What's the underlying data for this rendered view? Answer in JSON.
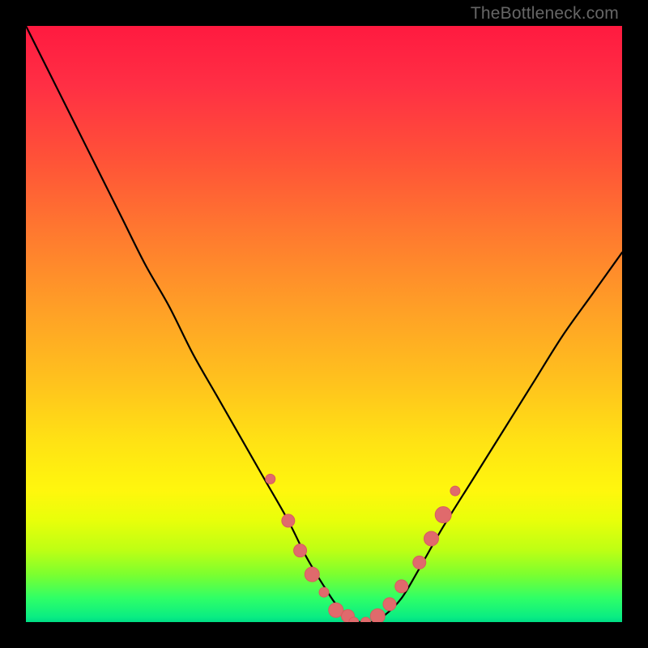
{
  "attribution": "TheBottleneck.com",
  "colors": {
    "curve_stroke": "#000000",
    "dot_fill": "#e06a6c",
    "dot_stroke": "#d85c5e"
  },
  "chart_data": {
    "type": "line",
    "title": "",
    "xlabel": "",
    "ylabel": "",
    "xlim": [
      0,
      100
    ],
    "ylim": [
      0,
      100
    ],
    "grid": false,
    "legend": false,
    "annotations": [],
    "curve": {
      "name": "bottleneck-curve",
      "x": [
        0,
        4,
        8,
        12,
        16,
        20,
        24,
        28,
        32,
        36,
        40,
        44,
        47,
        50,
        52,
        54,
        56,
        58,
        60,
        63,
        66,
        70,
        75,
        80,
        85,
        90,
        95,
        100
      ],
      "y": [
        100,
        92,
        84,
        76,
        68,
        60,
        53,
        45,
        38,
        31,
        24,
        17,
        11,
        6,
        3,
        1,
        0,
        0,
        1,
        4,
        9,
        16,
        24,
        32,
        40,
        48,
        55,
        62
      ]
    },
    "dots": {
      "name": "sampled-points",
      "x": [
        41,
        44,
        46,
        48,
        50,
        52,
        54,
        55,
        57,
        59,
        61,
        63,
        66,
        68,
        70,
        72
      ],
      "y": [
        24,
        17,
        12,
        8,
        5,
        2,
        1,
        0,
        0,
        1,
        3,
        6,
        10,
        14,
        18,
        22
      ],
      "r": [
        6,
        8,
        8,
        9,
        6,
        9,
        8,
        6,
        6,
        9,
        8,
        8,
        8,
        9,
        10,
        6
      ]
    }
  }
}
